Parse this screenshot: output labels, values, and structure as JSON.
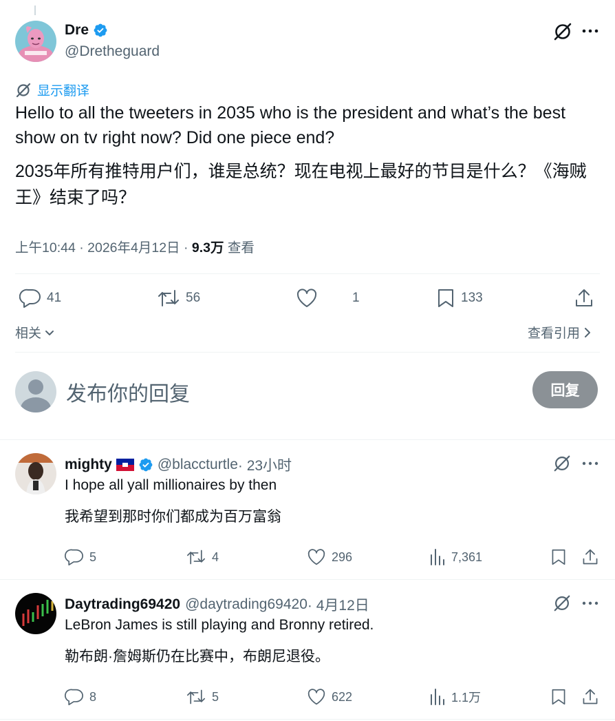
{
  "colors": {
    "accent": "#1d9bf0",
    "text": "#0f1419",
    "muted": "#536471",
    "divider": "#eff3f4",
    "reply_button_bg": "#8b9196"
  },
  "tweet": {
    "author_name": "Dre",
    "author_handle": "@Dretheguard",
    "translate_label": "显示翻译",
    "text_en": "Hello to all the tweeters in 2035 who is the president and what’s the best show on tv right now? Did one piece end?",
    "text_zh": "2035年所有推特用户们，谁是总统？现在电视上最好的节目是什么？《海贼王》结束了吗？",
    "time": "上午10:44 · 2026年4月12日 · ",
    "views_count": "9.3万",
    "views_label": " 查看",
    "stats": {
      "replies": "41",
      "retweets": "56",
      "likes": "1",
      "bookmarks": "133"
    },
    "related_label": "相关",
    "view_quotes_label": "查看引用"
  },
  "composer": {
    "placeholder": "发布你的回复",
    "button_label": "回复"
  },
  "replies": [
    {
      "name": "mighty",
      "handle": "@blaccturtle",
      "time": " · 23小时",
      "text_en": "I hope all yall millionaires by then",
      "text_zh": "我希望到那时你们都成为百万富翁",
      "stats": {
        "replies": "5",
        "retweets": "4",
        "likes": "296",
        "views": "7,361"
      }
    },
    {
      "name": "Daytrading69420",
      "handle": "@daytrading69420",
      "time": " · 4月12日",
      "text_en": "LeBron James is still playing and Bronny retired.",
      "text_zh": "勒布朗·詹姆斯仍在比赛中，布朗尼退役。",
      "stats": {
        "replies": "8",
        "retweets": "5",
        "likes": "622",
        "views": "1.1万"
      }
    }
  ]
}
